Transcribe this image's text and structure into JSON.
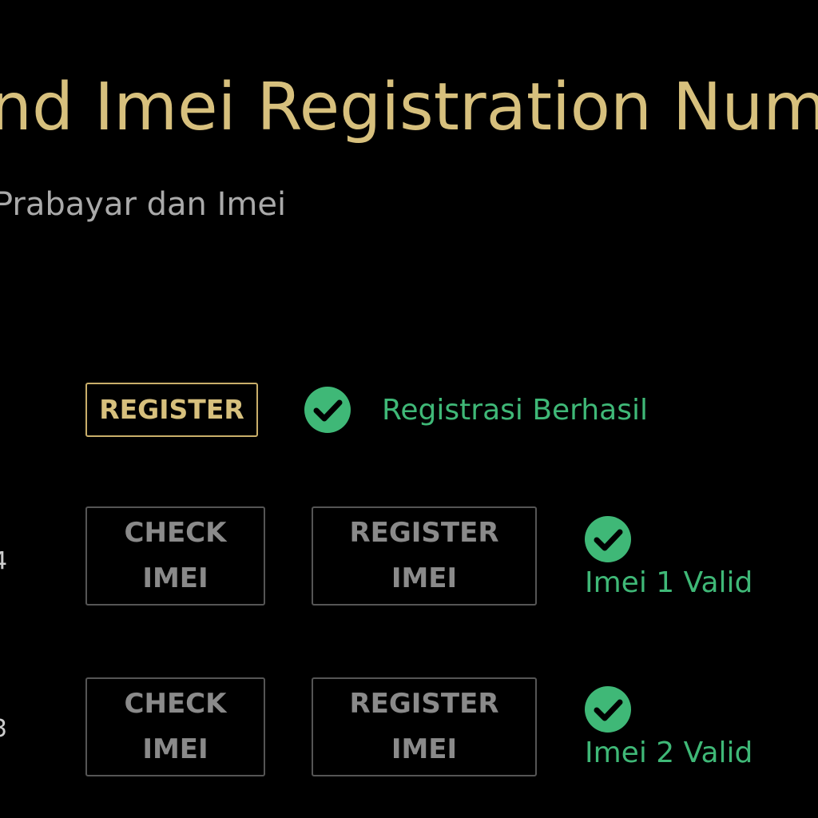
{
  "header": {
    "title": "nd Imei Registration Num",
    "subtitle": "Prabayar dan Imei"
  },
  "registration": {
    "button_label": "REGISTER",
    "status": "Registrasi Berhasil",
    "status_icon": "check-circle-icon"
  },
  "imei_rows": [
    {
      "edge_digit": "4",
      "check_label_line1": "CHECK",
      "check_label_line2": "IMEI",
      "register_label_line1": "REGISTER",
      "register_label_line2": "IMEI",
      "status": "Imei 1 Valid"
    },
    {
      "edge_digit": "3",
      "check_label_line1": "CHECK",
      "check_label_line2": "IMEI",
      "register_label_line1": "REGISTER",
      "register_label_line2": "IMEI",
      "status": "Imei 2 Valid"
    }
  ],
  "colors": {
    "background": "#000000",
    "accent_gold": "#d7c07d",
    "success_green": "#3fb877",
    "disabled_gray": "#8a8a8a"
  }
}
